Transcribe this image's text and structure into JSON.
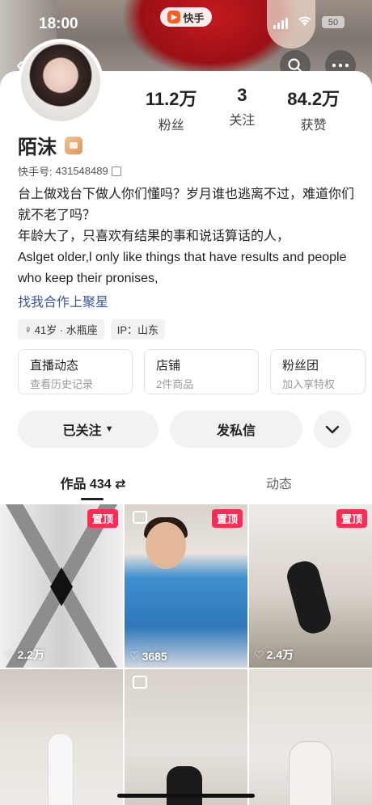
{
  "status_bar": {
    "time": "18:00",
    "app_label": "快手",
    "battery": "50"
  },
  "profile": {
    "name": "陌沫",
    "kuaishou_id_label": "快手号:",
    "kuaishou_id": "431548489",
    "stats": [
      {
        "value": "11.2万",
        "label": "粉丝"
      },
      {
        "value": "3",
        "label": "关注"
      },
      {
        "value": "84.2万",
        "label": "获赞"
      }
    ],
    "bio_lines": [
      "台上做戏台下做人你们懂吗？岁月谁也逃离不过，难道你们就不老了吗？",
      "年龄大了，只喜欢有结果的事和说话算话的人，",
      "Aslget older,l only like things that have results and people who keep their pronises,"
    ],
    "collab_link": "找我合作上聚星",
    "tags": {
      "age": "41岁 · 水瓶座",
      "ip": "IP：山东"
    }
  },
  "features": [
    {
      "title": "直播动态",
      "sub": "查看历史记录"
    },
    {
      "title": "店铺",
      "sub": "2件商品"
    },
    {
      "title": "粉丝团",
      "sub": "加入享特权"
    }
  ],
  "actions": {
    "follow": "已关注",
    "message": "发私信"
  },
  "tabs": {
    "works": "作品 434",
    "dynamics": "动态"
  },
  "grid": [
    {
      "pinned": "置顶",
      "likes": "2.2万"
    },
    {
      "pinned": "置顶",
      "likes": "3685"
    },
    {
      "pinned": "置顶",
      "likes": "2.4万"
    },
    {
      "pinned": "",
      "likes": ""
    },
    {
      "pinned": "",
      "likes": ""
    },
    {
      "pinned": "",
      "likes": ""
    }
  ],
  "colors": {
    "accent_pin": "#fe2c55",
    "link": "#3a5a9a"
  }
}
